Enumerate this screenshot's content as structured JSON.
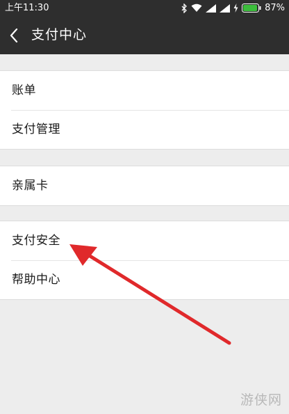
{
  "status_bar": {
    "time": "上午11:30",
    "battery_percent": "87%"
  },
  "nav": {
    "title": "支付中心"
  },
  "groups": [
    {
      "items": [
        {
          "label": "账单"
        },
        {
          "label": "支付管理"
        }
      ]
    },
    {
      "items": [
        {
          "label": "亲属卡"
        }
      ]
    },
    {
      "items": [
        {
          "label": "支付安全"
        },
        {
          "label": "帮助中心"
        }
      ]
    }
  ],
  "watermark": "游侠网",
  "colors": {
    "bar_background": "#2e2e2e",
    "page_background": "#ededed",
    "annotation_arrow": "#e0292b",
    "battery": "#3cbd3c"
  },
  "icons": [
    "back-arrow-icon",
    "bluetooth-icon",
    "wifi-icon",
    "signal-icon",
    "charging-icon",
    "battery-icon"
  ]
}
